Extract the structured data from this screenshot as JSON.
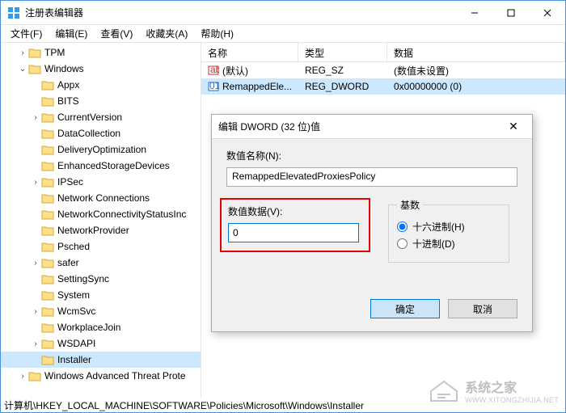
{
  "window": {
    "title": "注册表编辑器"
  },
  "menu": {
    "file": "文件(F)",
    "edit": "编辑(E)",
    "view": "查看(V)",
    "favorites": "收藏夹(A)",
    "help": "帮助(H)"
  },
  "tree": [
    {
      "label": "TPM",
      "indent": 1,
      "expand": "closed"
    },
    {
      "label": "Windows",
      "indent": 1,
      "expand": "open"
    },
    {
      "label": "Appx",
      "indent": 2,
      "expand": "none"
    },
    {
      "label": "BITS",
      "indent": 2,
      "expand": "none"
    },
    {
      "label": "CurrentVersion",
      "indent": 2,
      "expand": "closed"
    },
    {
      "label": "DataCollection",
      "indent": 2,
      "expand": "none"
    },
    {
      "label": "DeliveryOptimization",
      "indent": 2,
      "expand": "none"
    },
    {
      "label": "EnhancedStorageDevices",
      "indent": 2,
      "expand": "none"
    },
    {
      "label": "IPSec",
      "indent": 2,
      "expand": "closed"
    },
    {
      "label": "Network Connections",
      "indent": 2,
      "expand": "none"
    },
    {
      "label": "NetworkConnectivityStatusInc",
      "indent": 2,
      "expand": "none"
    },
    {
      "label": "NetworkProvider",
      "indent": 2,
      "expand": "none"
    },
    {
      "label": "Psched",
      "indent": 2,
      "expand": "none"
    },
    {
      "label": "safer",
      "indent": 2,
      "expand": "closed"
    },
    {
      "label": "SettingSync",
      "indent": 2,
      "expand": "none"
    },
    {
      "label": "System",
      "indent": 2,
      "expand": "none"
    },
    {
      "label": "WcmSvc",
      "indent": 2,
      "expand": "closed"
    },
    {
      "label": "WorkplaceJoin",
      "indent": 2,
      "expand": "none"
    },
    {
      "label": "WSDAPI",
      "indent": 2,
      "expand": "closed"
    },
    {
      "label": "Installer",
      "indent": 2,
      "expand": "none",
      "selected": true
    },
    {
      "label": "Windows Advanced Threat Prote",
      "indent": 1,
      "expand": "closed"
    }
  ],
  "list": {
    "headers": {
      "name": "名称",
      "type": "类型",
      "data": "数据"
    },
    "rows": [
      {
        "icon": "string",
        "name": "(默认)",
        "type": "REG_SZ",
        "data": "(数值未设置)",
        "selected": false
      },
      {
        "icon": "binary",
        "name": "RemappedEle...",
        "type": "REG_DWORD",
        "data": "0x00000000 (0)",
        "selected": true
      }
    ]
  },
  "dialog": {
    "title": "编辑 DWORD (32 位)值",
    "name_label": "数值名称(N):",
    "name_value": "RemappedElevatedProxiesPolicy",
    "data_label": "数值数据(V):",
    "data_value": "0",
    "radix_label": "基数",
    "radix_hex": "十六进制(H)",
    "radix_dec": "十进制(D)",
    "ok": "确定",
    "cancel": "取消"
  },
  "statusbar": "计算机\\HKEY_LOCAL_MACHINE\\SOFTWARE\\Policies\\Microsoft\\Windows\\Installer",
  "watermark": {
    "cn": "系统之家",
    "en": "WWW.XITONGZHIJIA.NET"
  }
}
